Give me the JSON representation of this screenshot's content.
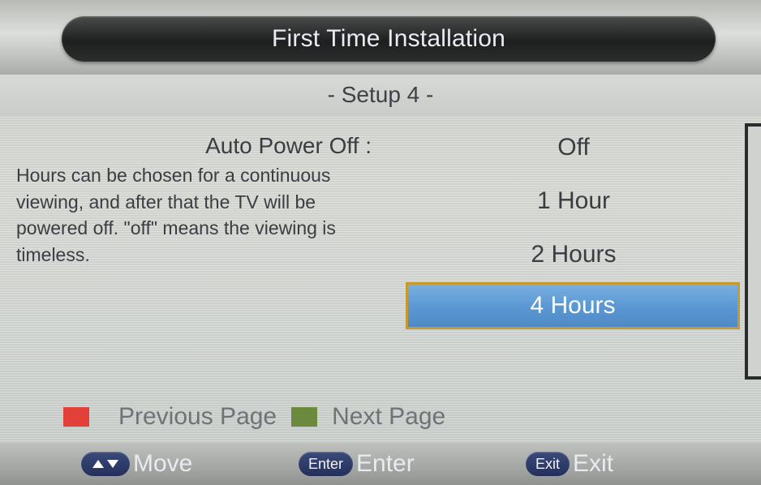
{
  "header": {
    "title": "First Time Installation",
    "subtitle": "- Setup 4 -"
  },
  "setting": {
    "label": "Auto Power Off :",
    "description": "Hours can be chosen for a continuous viewing, and after that the TV will be powered off. \"off\" means the viewing is timeless.",
    "options": [
      "Off",
      "1 Hour",
      "2 Hours",
      "4 Hours"
    ],
    "selected_index": 3
  },
  "color_keys": [
    {
      "label": "Previous Page",
      "color": "#e2413a"
    },
    {
      "label": "Next Page",
      "color": "#6b8a3e"
    }
  ],
  "bottom_hints": {
    "move": {
      "label": "Move"
    },
    "enter": {
      "chip": "Enter",
      "label": "Enter"
    },
    "exit": {
      "chip": "Exit",
      "label": "Exit"
    }
  },
  "colors": {
    "accent": "#5b98d4",
    "highlight_border": "#c79a2e",
    "hint_chip": "#2c3a68"
  }
}
